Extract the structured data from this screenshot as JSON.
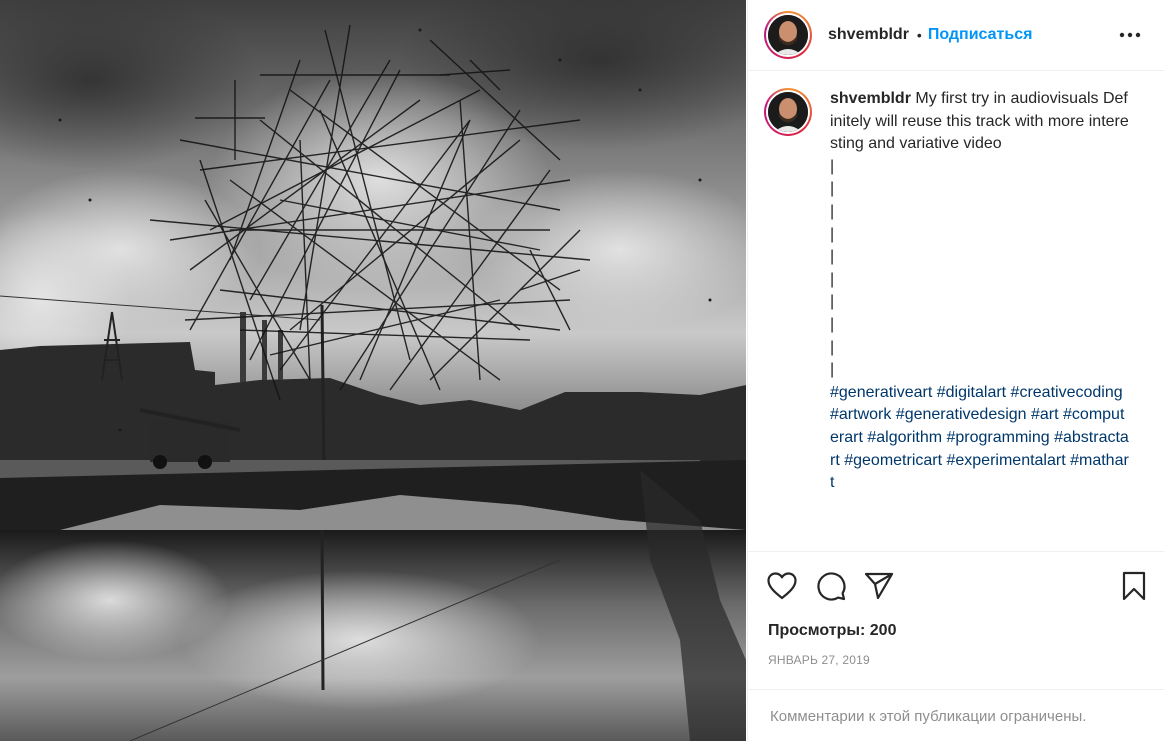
{
  "post": {
    "username": "shvembldr",
    "separator": "•",
    "follow_label": "Подписаться",
    "caption_user": "shvembldr",
    "caption_text": " My first try in audiovisuals Definitely will reuse this track with more interesting and variative video\n|\n|\n|\n|\n|\n|\n|\n|\n|\n|\n",
    "hashtags": "#generativeart #digitalart #creativecoding #artwork #generativedesign #art #computerart #algorithm #programming #abstractart #geometricart #experimentalart #mathart",
    "views": "Просмотры: 200",
    "date": "ЯНВАРЬ 27, 2019",
    "comments_closed": "Комментарии к этой публикации ограничены."
  },
  "icons": {
    "more": "more-options-icon",
    "like": "heart-icon",
    "comment": "comment-icon",
    "share": "paper-plane-icon",
    "save": "bookmark-icon"
  },
  "colors": {
    "link_blue": "#0095f6",
    "hashtag": "#00376b",
    "muted": "#8e8e8e",
    "text": "#262626"
  }
}
